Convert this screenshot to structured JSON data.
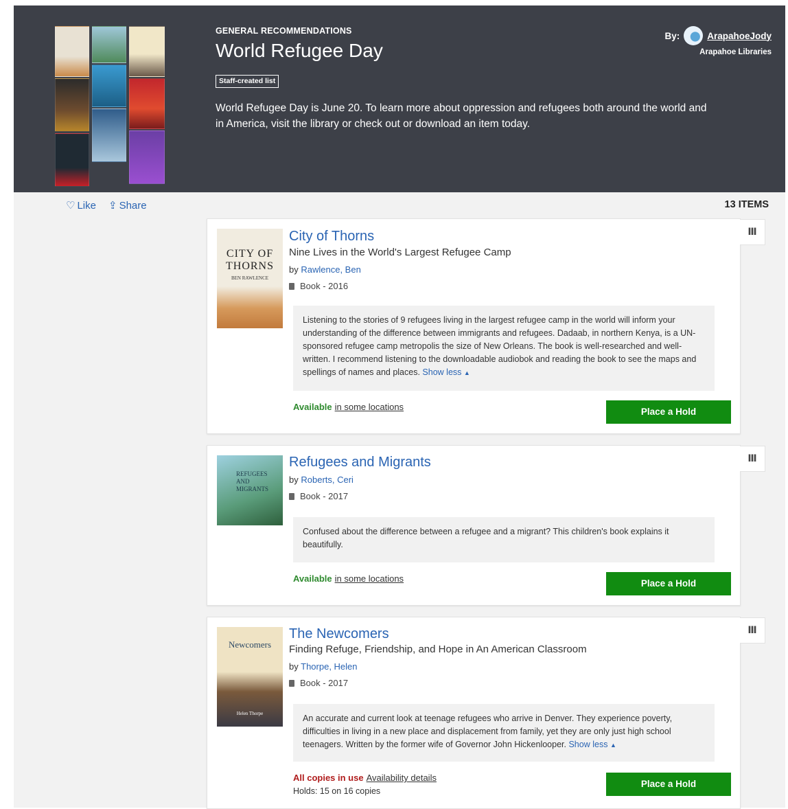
{
  "list": {
    "eyebrow": "GENERAL RECOMMENDATIONS",
    "title": "World Refugee Day",
    "badge": "Staff-created list",
    "description": "World Refugee Day is June 20. To learn more about oppression and refugees both around the world and in America, visit the library or check out or download an item today.",
    "by_label": "By:",
    "author": "ArapahoeJody",
    "org": "Arapahoe Libraries",
    "like_label": "Like",
    "share_label": "Share",
    "item_count": "13 ITEMS"
  },
  "colors": {
    "header_bg": "#3d4048",
    "link_blue": "#2a64b3",
    "hold_green": "#118c11",
    "available_green": "#2e8a2e",
    "in_use_red": "#b01c1c"
  },
  "items": [
    {
      "title": "City of Thorns",
      "subtitle": "Nine Lives in the World's Largest Refugee Camp",
      "by": "by",
      "author": "Rawlence, Ben",
      "format": "Book - 2016",
      "note": "Listening to the stories of 9 refugees living in the largest refugee camp in the world will inform your understanding of the difference between immigrants and refugees. Dadaab, in northern Kenya, is a UN-sponsored refugee camp metropolis the size of New Orleans. The book is well-researched and well-written. I recommend listening to the downloadable audiobok and reading the book to see the maps and spellings of names and places.",
      "toggle": "Show less",
      "status": "Available",
      "status_link": "in some locations",
      "hold": "Place a Hold",
      "cover_text": "CITY OF THORNS",
      "cover_author": "BEN RAWLENCE"
    },
    {
      "title": "Refugees and Migrants",
      "by": "by",
      "author": "Roberts, Ceri",
      "format": "Book - 2017",
      "note": "Confused about the difference between a refugee and a migrant? This children's book explains it beautifully.",
      "status": "Available",
      "status_link": "in some locations",
      "hold": "Place a Hold",
      "cover_text": "REFUGEES AND MIGRANTS"
    },
    {
      "title": "The Newcomers",
      "subtitle": "Finding Refuge, Friendship, and Hope in An American Classroom",
      "by": "by",
      "author": "Thorpe, Helen",
      "format": "Book - 2017",
      "note": "An accurate and current look at teenage refugees who arrive in Denver. They experience poverty, difficulties in living in a new place and displacement from family, yet they are only just high school teenagers. Written by the former wife of Governor John Hickenlooper.",
      "toggle": "Show less",
      "status": "All copies in use",
      "status_link": "Availability details",
      "holds": "Holds: 15 on 16 copies",
      "hold": "Place a Hold",
      "cover_text": "Newcomers",
      "cover_author": "Helen Thorpe"
    }
  ],
  "shelf_icon": "shelf-icon"
}
